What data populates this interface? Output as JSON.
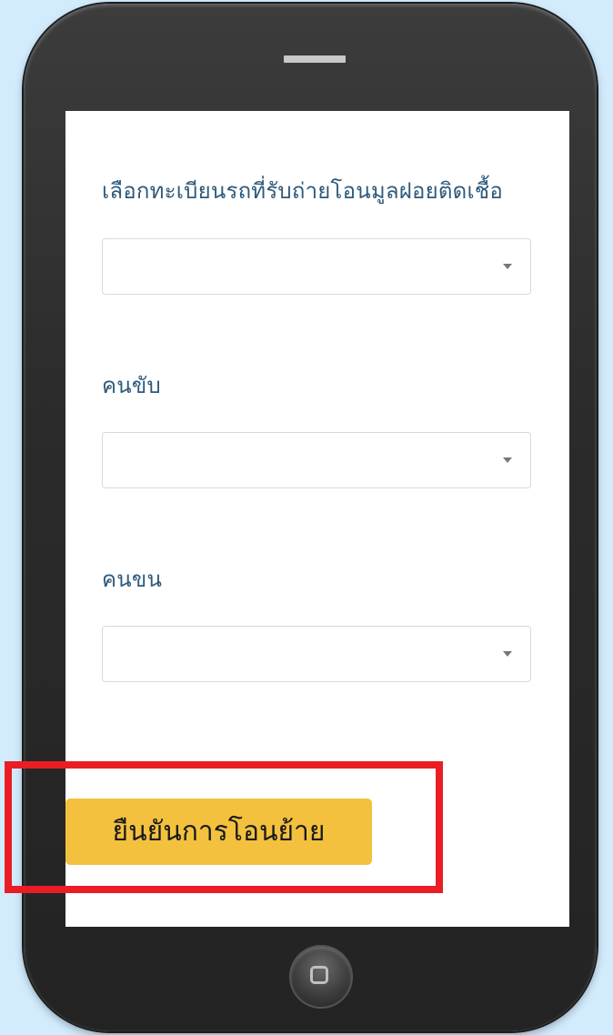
{
  "form": {
    "vehicle_label": "เลือกทะเบียนรถที่รับถ่ายโอนมูลฝอยติดเชื้อ",
    "vehicle_value": "",
    "driver_label": "คนขับ",
    "driver_value": "",
    "loader_label": "คนขน",
    "loader_value": ""
  },
  "actions": {
    "confirm_label": "ยืนยันการโอนย้าย"
  },
  "colors": {
    "background": "#d2ecfe",
    "phone_body": "#2b2b2b",
    "label_text": "#2e5a7c",
    "confirm_button": "#f3c13e",
    "highlight_border": "#ea1d25"
  },
  "icons": {
    "select_caret": "caret-down-icon",
    "home": "home-button-icon"
  }
}
